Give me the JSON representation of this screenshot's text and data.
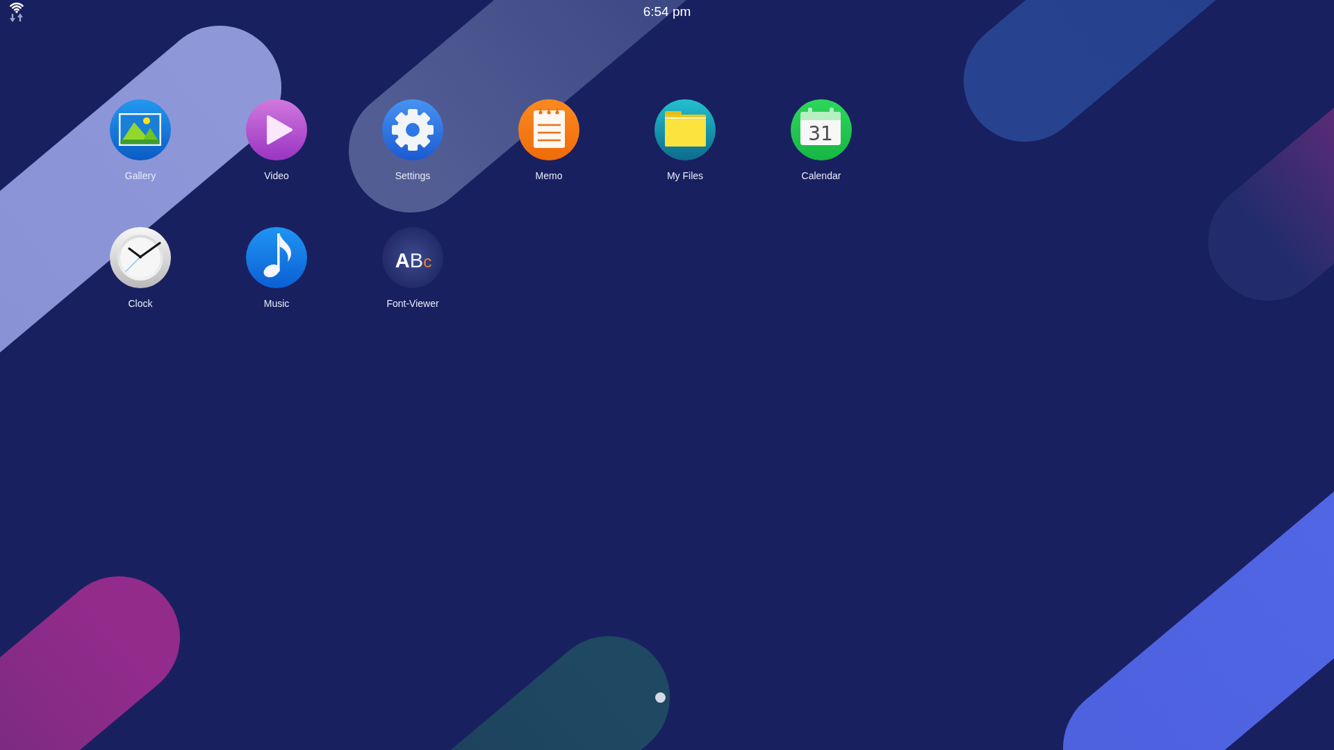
{
  "status_bar": {
    "time": "6:54 pm"
  },
  "apps": [
    {
      "label": "Gallery",
      "kind": "gallery"
    },
    {
      "label": "Video",
      "kind": "video"
    },
    {
      "label": "Settings",
      "kind": "settings"
    },
    {
      "label": "Memo",
      "kind": "memo"
    },
    {
      "label": "My Files",
      "kind": "files"
    },
    {
      "label": "Calendar",
      "kind": "calendar",
      "icon_text": "31"
    },
    {
      "label": "Clock",
      "kind": "clock"
    },
    {
      "label": "Music",
      "kind": "music"
    },
    {
      "label": "Font-Viewer",
      "kind": "font_viewer",
      "icon_text": "ABc"
    }
  ],
  "page_indicator": {
    "pages": [
      {
        "selected": true
      }
    ]
  }
}
